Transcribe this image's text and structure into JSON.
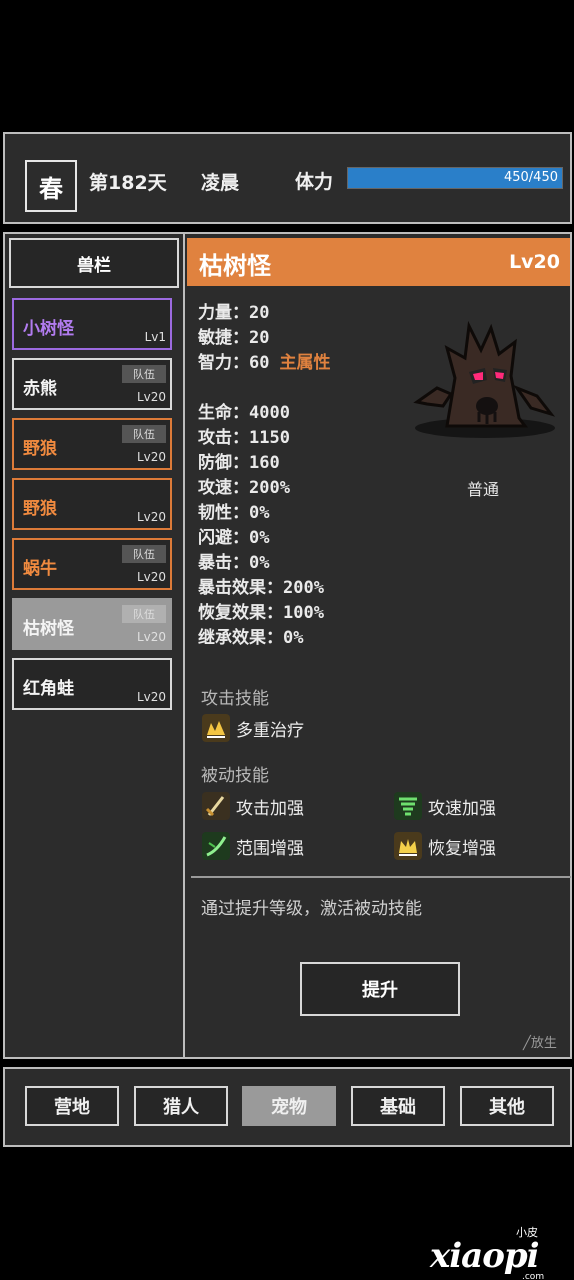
{
  "topbar": {
    "season": "春",
    "day": "第182天",
    "time_of_day": "凌晨",
    "stamina_label": "体力",
    "stamina_text": "450/450",
    "stamina_ratio": 1.0,
    "stamina_color": "#2a7fc9"
  },
  "pen": {
    "header": "兽栏",
    "pets": [
      {
        "name": "小树怪",
        "level": "Lv1",
        "team": "",
        "style": "purple"
      },
      {
        "name": "赤熊",
        "level": "Lv20",
        "team": "队伍",
        "style": "normal"
      },
      {
        "name": "野狼",
        "level": "Lv20",
        "team": "队伍",
        "style": "orange"
      },
      {
        "name": "野狼",
        "level": "Lv20",
        "team": "",
        "style": "orange"
      },
      {
        "name": "蜗牛",
        "level": "Lv20",
        "team": "队伍",
        "style": "orange"
      },
      {
        "name": "枯树怪",
        "level": "Lv20",
        "team": "队伍",
        "style": "selected"
      },
      {
        "name": "红角蛙",
        "level": "Lv20",
        "team": "",
        "style": "normal"
      }
    ]
  },
  "detail": {
    "name": "枯树怪",
    "level": "Lv20",
    "header_color": "#e0823f",
    "rarity": "普通",
    "main_attr_tag": "主属性",
    "stats": [
      {
        "label": "力量",
        "value": "20"
      },
      {
        "label": "敏捷",
        "value": "20"
      },
      {
        "label": "智力",
        "value": "60"
      },
      {
        "label": "生命",
        "value": "4000"
      },
      {
        "label": "攻击",
        "value": "1150"
      },
      {
        "label": "防御",
        "value": "160"
      },
      {
        "label": "攻速",
        "value": "200%"
      },
      {
        "label": "韧性",
        "value": "0%"
      },
      {
        "label": "闪避",
        "value": "0%"
      },
      {
        "label": "暴击",
        "value": "0%"
      },
      {
        "label": "暴击效果",
        "value": "200%"
      },
      {
        "label": "恢复效果",
        "value": "100%"
      },
      {
        "label": "继承效果",
        "value": "0%"
      }
    ],
    "colon": "：",
    "attack_skill_title": "攻击技能",
    "attack_skills": [
      {
        "name": "多重治疗",
        "icon": "multi-heal-icon"
      }
    ],
    "passive_skill_title": "被动技能",
    "passive_skills": [
      {
        "name": "攻击加强",
        "icon": "sword-icon"
      },
      {
        "name": "攻速加强",
        "icon": "whirlwind-icon"
      },
      {
        "name": "范围增强",
        "icon": "slash-icon"
      },
      {
        "name": "恢复增强",
        "icon": "crown-icon"
      }
    ],
    "hint": "通过提升等级，激活被动技能",
    "upgrade_label": "提升",
    "release_label": "╱放生"
  },
  "nav": {
    "tabs": [
      "营地",
      "猎人",
      "宠物",
      "基础",
      "其他"
    ],
    "active_index": 2
  },
  "watermark": {
    "small": "小皮",
    "big": "xiaopi",
    "domain": ".com"
  }
}
